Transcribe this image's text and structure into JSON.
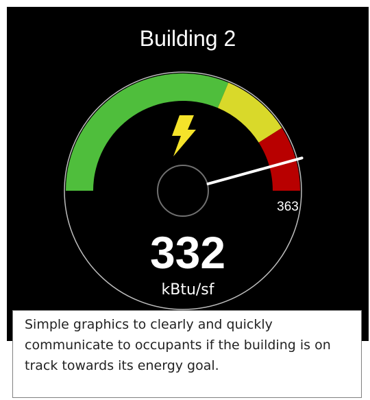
{
  "widget": {
    "title": "Building 2",
    "value": "332",
    "unit": "kBtu/sf",
    "max_label": "363",
    "gauge": {
      "min": 0,
      "max": 363,
      "reading": 332,
      "segments": [
        {
          "name": "good",
          "from": 0,
          "to": 0.627,
          "color": "#4fbe3c"
        },
        {
          "name": "caution",
          "from": 0.627,
          "to": 0.82,
          "color": "#d9d92a"
        },
        {
          "name": "over",
          "from": 0.82,
          "to": 1.0,
          "color": "#b80000"
        }
      ],
      "icon": "lightning-bolt-icon",
      "icon_color": "#f5e32a",
      "needle_color": "#ffffff"
    }
  },
  "caption": {
    "text": "Simple graphics to clearly and quickly communicate to occupants if the building is on track towards its energy goal."
  }
}
